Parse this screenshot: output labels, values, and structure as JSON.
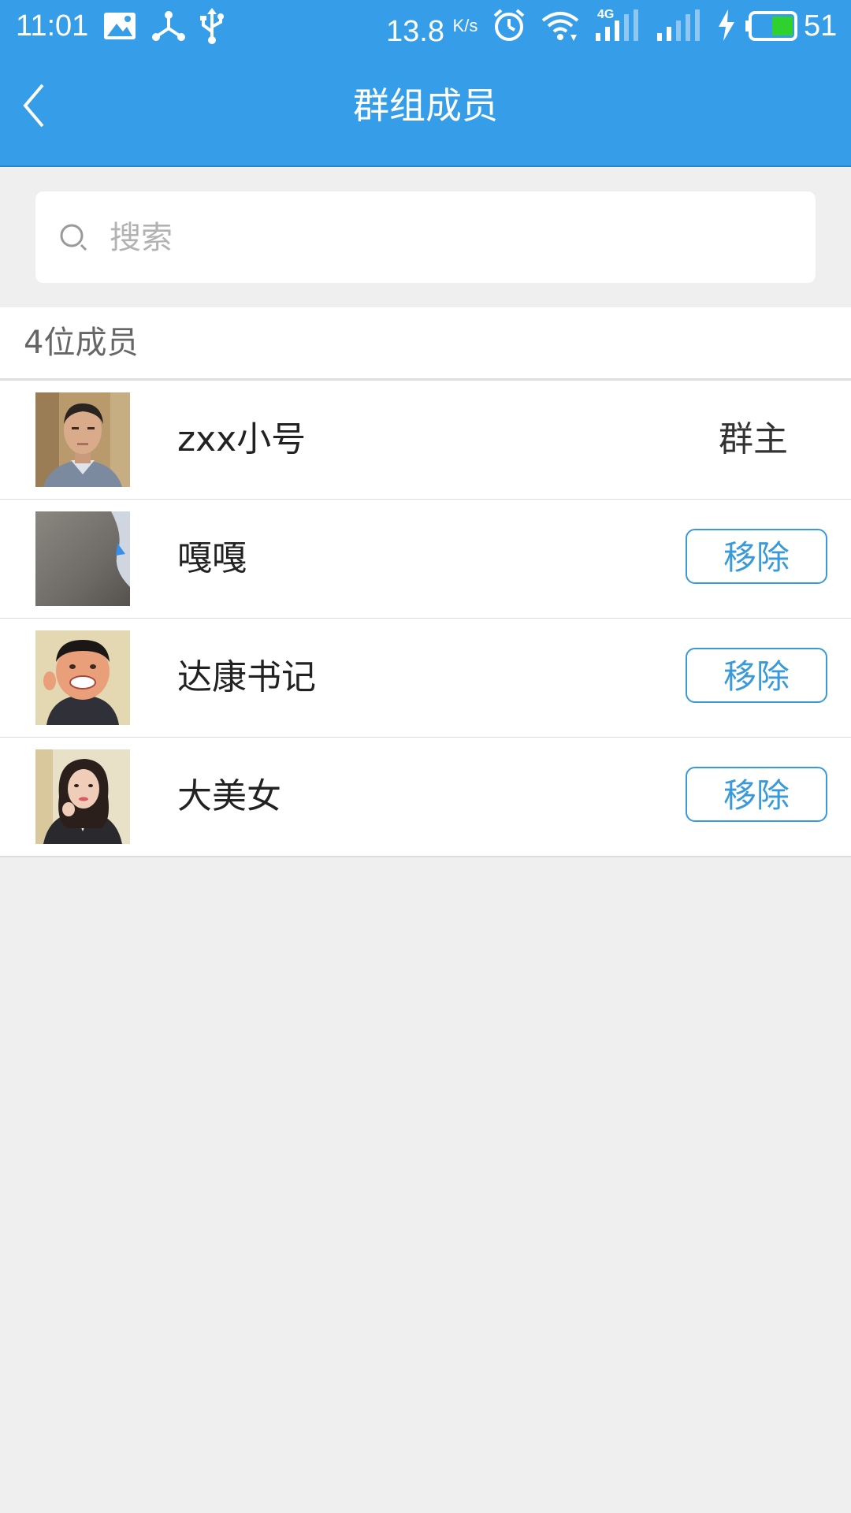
{
  "status_bar": {
    "time": "11:01",
    "speed_value": "13.8",
    "speed_unit": "K/s",
    "network_label": "4G",
    "battery_percent": "51",
    "icons": [
      "image-icon",
      "share-node-icon",
      "usb-icon",
      "alarm-icon",
      "wifi-icon",
      "signal-4g-icon",
      "signal-icon",
      "charging-icon",
      "battery-icon"
    ]
  },
  "app_bar": {
    "title": "群组成员",
    "back_icon": "chevron-left-icon"
  },
  "search": {
    "placeholder": "搜索",
    "value": "",
    "icon": "search-icon"
  },
  "members": {
    "count_label": "4位成员",
    "items": [
      {
        "name": "zxx小号",
        "role": "群主",
        "action": ""
      },
      {
        "name": "嘎嘎",
        "role": "",
        "action": "移除"
      },
      {
        "name": "达康书记",
        "role": "",
        "action": "移除"
      },
      {
        "name": "大美女",
        "role": "",
        "action": "移除"
      }
    ]
  },
  "colors": {
    "primary": "#369ee8",
    "page_background": "#efefef",
    "button_accent": "#3a9ad9",
    "battery_fill": "#2fd12f"
  }
}
